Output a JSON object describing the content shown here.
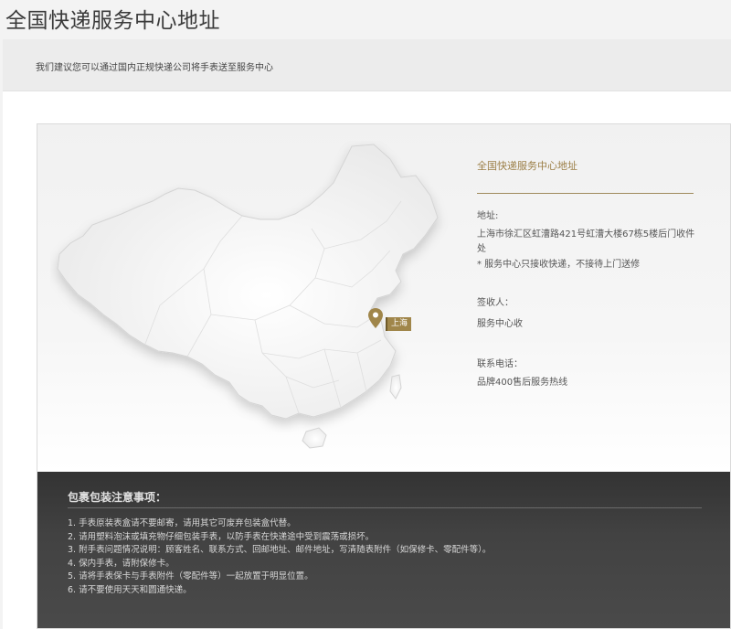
{
  "page": {
    "title": "全国快递服务中心地址",
    "intro": "我们建议您可以通过国内正规快递公司将手表送至服务中心"
  },
  "map": {
    "city_label": "上海",
    "marker_color": "#a0864a"
  },
  "info": {
    "title": "全国快递服务中心地址",
    "address_label": "地址:",
    "address_value": "上海市徐汇区虹漕路421号虹漕大楼67栋5楼后门收件处",
    "address_note": "* 服务中心只接收快递，不接待上门送修",
    "receiver_label": "签收人：",
    "receiver_value": "服务中心收",
    "phone_label": "联系电话：",
    "phone_value": "品牌400售后服务热线",
    "accent_color": "#9c7f47"
  },
  "notes": {
    "title": "包裹包装注意事项：",
    "items": [
      "1. 手表原装表盒请不要邮寄，请用其它可废弃包装盒代替。",
      "2. 请用塑料泡沫或填充物仔细包装手表，以防手表在快递途中受到震荡或损坏。",
      "3. 附手表问题情况说明：顾客姓名、联系方式、回邮地址、邮件地址，写清随表附件（如保修卡、零配件等）。",
      "4. 保内手表，请附保修卡。",
      "5. 请将手表保卡与手表附件（零配件等）一起放置于明显位置。",
      "6. 请不要使用天天和圆通快递。"
    ]
  }
}
